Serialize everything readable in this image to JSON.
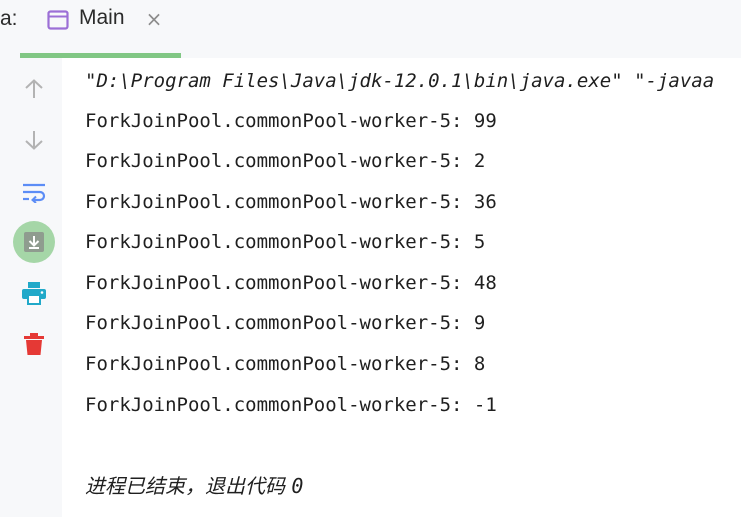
{
  "tab_prefix": "a:",
  "tab": {
    "label": "Main",
    "close_glyph": "×",
    "icon": "window-icon",
    "underline_color": "#81c784"
  },
  "toolbar": [
    {
      "name": "scroll-up-icon",
      "color": "#b0b0b0"
    },
    {
      "name": "scroll-down-icon",
      "color": "#b0b0b0"
    },
    {
      "name": "soft-wrap-icon",
      "color": "#5c8df6"
    },
    {
      "name": "scroll-to-end-icon",
      "color": "#9e9e9e",
      "active": true
    },
    {
      "name": "print-icon",
      "color": "#21a9c9"
    },
    {
      "name": "trash-icon",
      "color": "#e53935"
    }
  ],
  "console": {
    "command": "\"D:\\Program Files\\Java\\jdk-12.0.1\\bin\\java.exe\" \"-javaa",
    "output": [
      "ForkJoinPool.commonPool-worker-5: 99",
      "ForkJoinPool.commonPool-worker-5: 2",
      "ForkJoinPool.commonPool-worker-5: 36",
      "ForkJoinPool.commonPool-worker-5: 5",
      "ForkJoinPool.commonPool-worker-5: 48",
      "ForkJoinPool.commonPool-worker-5: 9",
      "ForkJoinPool.commonPool-worker-5: 8",
      "ForkJoinPool.commonPool-worker-5: -1"
    ],
    "exit_message": "进程已结束，退出代码 ",
    "exit_code": "0"
  }
}
